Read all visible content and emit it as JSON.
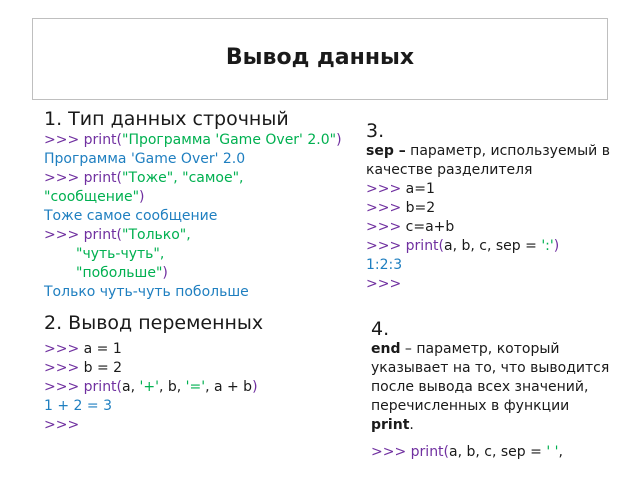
{
  "title": "Вывод данных",
  "s1": {
    "heading": "1. Тип данных строчный",
    "l1_prompt": ">>> ",
    "l1_fn": "print(",
    "l1_str": "\"Программа 'Game Over' 2.0\"",
    "l1_close": ")",
    "l2": "Программа 'Game Over' 2.0",
    "l3_prompt": ">>> ",
    "l3_fn": "print(",
    "l3_str": "\"Тоже\", \"самое\", \"сообщение\"",
    "l3_close": ")",
    "l4": "Тоже самое сообщение",
    "l5_prompt": ">>> ",
    "l5_fn": "print(",
    "l5_str1": "\"Только\",",
    "l5_str2": "\"чуть-чуть\",",
    "l5_str3": "\"побольше\"",
    "l5_close": ")",
    "l6": "Только чуть-чуть побольше"
  },
  "s2": {
    "heading": "2. Вывод переменных",
    "l1_prompt": ">>> ",
    "l1_code": "a = 1",
    "l2_prompt": ">>> ",
    "l2_code": "b = 2",
    "l3_prompt": ">>> ",
    "l3_fn": "print(",
    "l3_a": "a, ",
    "l3_plus": "'+'",
    "l3_b": ", b, ",
    "l3_eq": "'='",
    "l3_rest": ", a + b",
    "l3_close": ")",
    "l4": "1 + 2 = 3",
    "l5_prompt": ">>>"
  },
  "s3": {
    "number": "3.",
    "sep_kw": "sep –",
    "desc": " параметр, используемый в качестве разделителя",
    "l1_prompt": ">>> ",
    "l1_code": "a=1",
    "l2_prompt": ">>> ",
    "l2_code": "b=2",
    "l3_prompt": ">>> ",
    "l3_code": "c=a+b",
    "l4_prompt": ">>> ",
    "l4_fn": "print(",
    "l4_args": "a, b, c, sep = ",
    "l4_str": "':'",
    "l4_close": ")",
    "l5": "1:2:3",
    "l6_prompt": ">>>"
  },
  "s4": {
    "number": "4.",
    "end_kw": "end",
    "desc": " – параметр, который указывает на то, что выводится после вывода всех значений, перечисленных в функции ",
    "print_kw": "print",
    "dot": ".",
    "l1_prompt": ">>> ",
    "l1_fn": "print(",
    "l1_args": "a, b, c, sep = ",
    "l1_str": "' '",
    "l1_comma": ","
  }
}
